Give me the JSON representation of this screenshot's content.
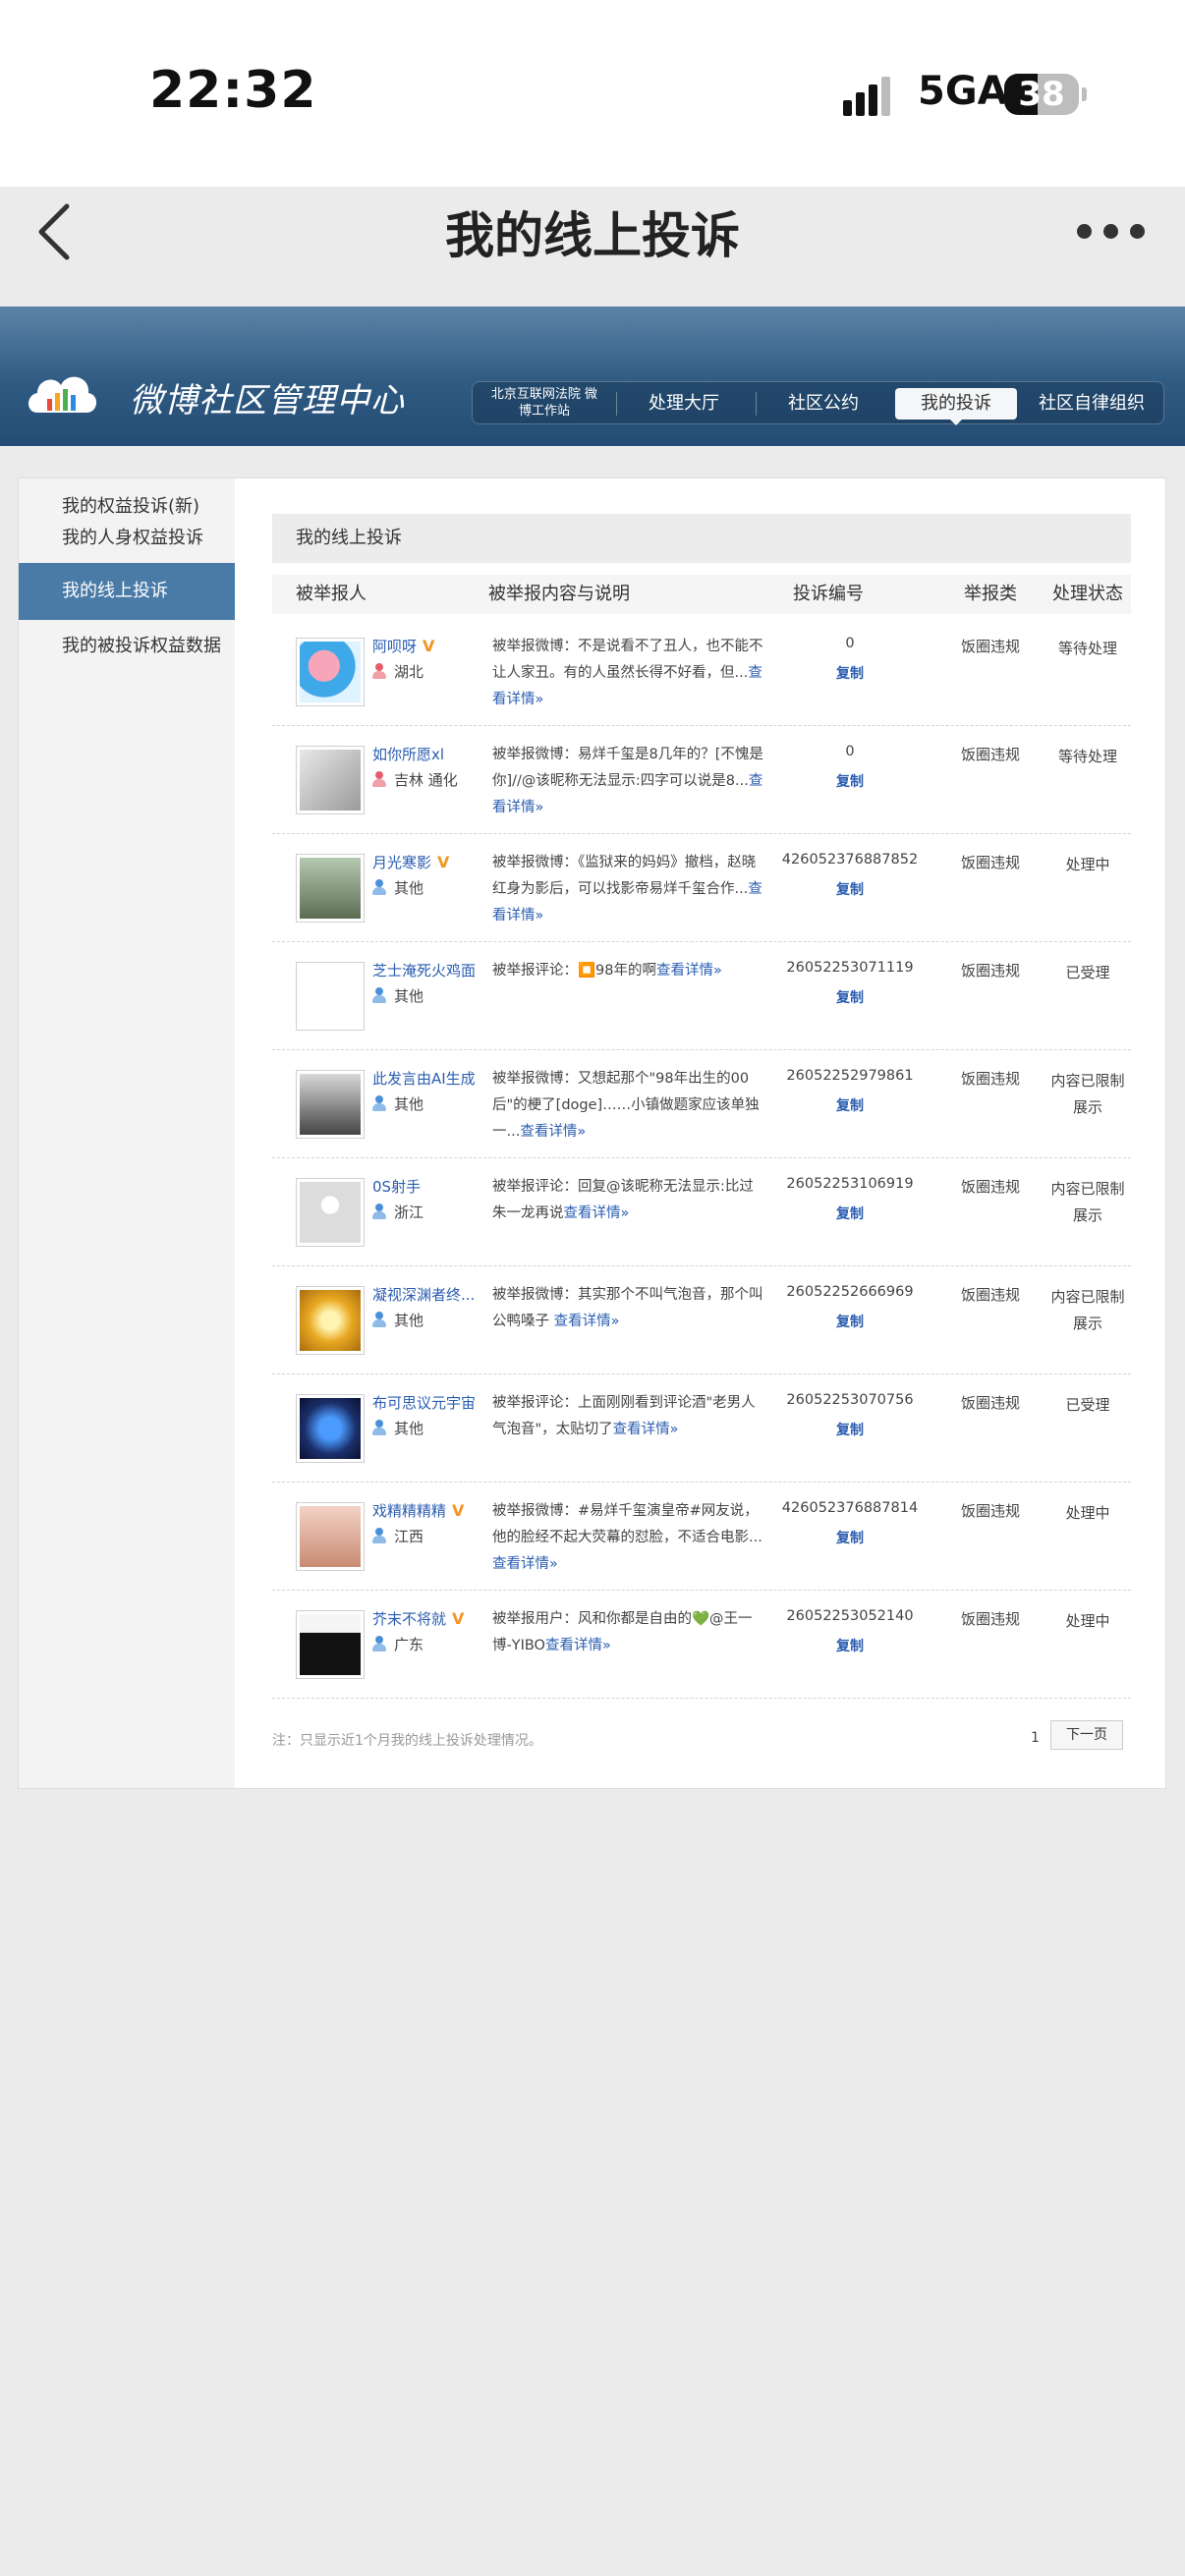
{
  "status_bar": {
    "time": "22:32",
    "network": "5GA",
    "battery": "38"
  },
  "header": {
    "title": "我的线上投诉"
  },
  "banner": {
    "logo_text": "微博社区管理中心",
    "court_label": "北京互联网法院 微博工作站",
    "nav": [
      "处理大厅",
      "社区公约",
      "我的投诉",
      "社区自律组织"
    ]
  },
  "sidebar": {
    "items": [
      "我的权益投诉(新)",
      "我的人身权益投诉(旧)",
      "我的线上投诉",
      "我的被投诉权益数据"
    ]
  },
  "content": {
    "title": "我的线上投诉",
    "columns": [
      "被举报人",
      "被举报内容与说明",
      "投诉编号",
      "举报类",
      "处理状态"
    ],
    "copy_label": "复制",
    "more_label": "查看详情»",
    "rows": [
      {
        "user": "阿呗呀",
        "verified": true,
        "location": "湖北",
        "desc": "被举报微博：不是说看不了丑人，也不能不让人家丑。有的人虽然长得不好看，但...",
        "id": "0",
        "category": "饭圈违规",
        "status": "等待处理"
      },
      {
        "user": "如你所愿xl",
        "verified": false,
        "location": "吉林 通化",
        "desc": "被举报微博：易烊千玺是8几年的？[不愧是你]//@该昵称无法显示:四字可以说是8...",
        "id": "0",
        "category": "饭圈违规",
        "status": "等待处理"
      },
      {
        "user": "月光寒影",
        "verified": true,
        "location": "其他",
        "desc": "被举报微博：《监狱来的妈妈》撤档，赵晓红身为影后，可以找影帝易烊千玺合作...",
        "id": "426052376887852",
        "category": "饭圈违规",
        "status": "处理中"
      },
      {
        "user": "芝士淹死火鸡面",
        "verified": false,
        "location": "其他",
        "desc": "被举报评论：⏹️98年的啊",
        "id": "26052253071119",
        "category": "饭圈违规",
        "status": "已受理"
      },
      {
        "user": "此发言由AI生成",
        "verified": false,
        "location": "其他",
        "desc": "被举报微博：又想起那个\"98年出生的00后\"的梗了[doge]……小镇做题家应该单独一...",
        "id": "26052252979861",
        "category": "饭圈违规",
        "status": "内容已限制展示"
      },
      {
        "user": "0S射手",
        "verified": false,
        "location": "浙江",
        "desc": "被举报评论：回复@该昵称无法显示:比过朱一龙再说",
        "id": "26052253106919",
        "category": "饭圈违规",
        "status": "内容已限制展示"
      },
      {
        "user": "凝视深渊者终...",
        "verified": false,
        "location": "其他",
        "desc": "被举报微博：其实那个不叫气泡音，那个叫公鸭嗓子 ",
        "id": "26052252666969",
        "category": "饭圈违规",
        "status": "内容已限制展示"
      },
      {
        "user": "布可思议元宇宙",
        "verified": false,
        "location": "其他",
        "desc": "被举报评论：上面刚刚看到评论酒\"老男人气泡音\"，太贴切了",
        "id": "26052253070756",
        "category": "饭圈违规",
        "status": "已受理"
      },
      {
        "user": "戏精精精精",
        "verified": true,
        "location": "江西",
        "desc": "被举报微博：#易烊千玺演皇帝#网友说，他的脸经不起大荧幕的怼脸，不适合电影...",
        "id": "426052376887814",
        "category": "饭圈违规",
        "status": "处理中"
      },
      {
        "user": "芥末不将就",
        "verified": true,
        "location": "广东",
        "desc": "被举报用户：风和你都是自由的💚@王一博-YIBO",
        "id": "26052253052140",
        "category": "饭圈违规",
        "status": "处理中"
      }
    ]
  },
  "footer": {
    "note": "注：只显示近1个月我的线上投诉处理情况。",
    "page": "1",
    "next_label": "下一页"
  },
  "colors": {
    "banner": "#2f5a82",
    "accent": "#4a7aa6",
    "link": "#2a5db0",
    "verified": "#f19520"
  }
}
